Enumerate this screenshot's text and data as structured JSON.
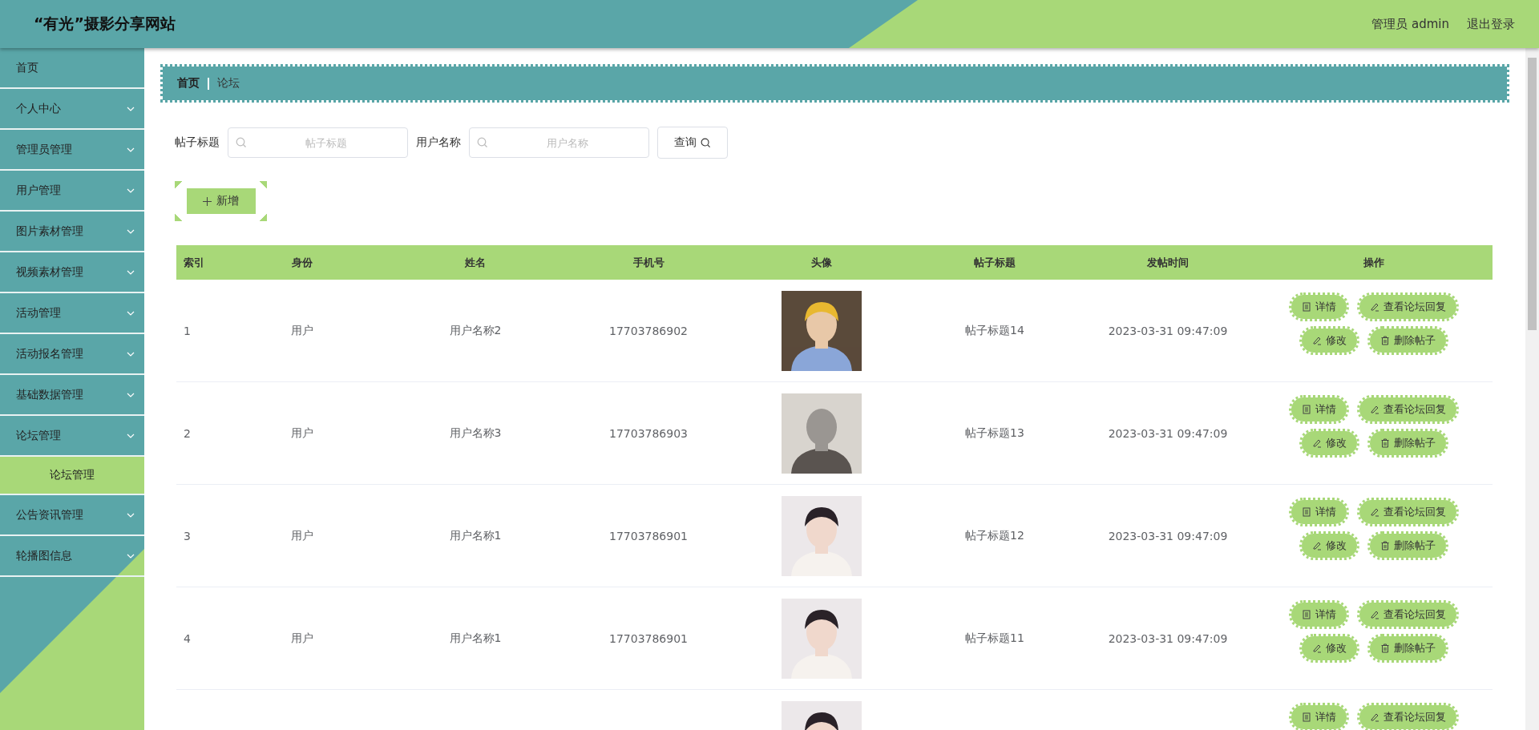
{
  "header": {
    "title": "“有光”摄影分享网站",
    "user": "管理员 admin",
    "logout": "退出登录"
  },
  "sidebar": {
    "items": [
      {
        "label": "首页",
        "kind": "link"
      },
      {
        "label": "个人中心",
        "kind": "menu"
      },
      {
        "label": "管理员管理",
        "kind": "menu"
      },
      {
        "label": "用户管理",
        "kind": "menu"
      },
      {
        "label": "图片素材管理",
        "kind": "menu"
      },
      {
        "label": "视频素材管理",
        "kind": "menu"
      },
      {
        "label": "活动管理",
        "kind": "menu"
      },
      {
        "label": "活动报名管理",
        "kind": "menu"
      },
      {
        "label": "基础数据管理",
        "kind": "menu"
      },
      {
        "label": "论坛管理",
        "kind": "menu",
        "children": [
          {
            "label": "论坛管理",
            "selected": true
          }
        ]
      },
      {
        "label": "公告资讯管理",
        "kind": "menu"
      },
      {
        "label": "轮播图信息",
        "kind": "menu"
      }
    ]
  },
  "breadcrumb": [
    "首页",
    "论坛"
  ],
  "search": {
    "fields": [
      {
        "label": "帖子标题",
        "placeholder": "帖子标题"
      },
      {
        "label": "用户名称",
        "placeholder": "用户名称"
      }
    ],
    "button": "查询"
  },
  "add_button": "新增",
  "table": {
    "columns": [
      "索引",
      "身份",
      "姓名",
      "手机号",
      "头像",
      "帖子标题",
      "发帖时间",
      "操作"
    ],
    "rows": [
      {
        "index": "1",
        "role": "用户",
        "name": "用户名称2",
        "phone": "17703786902",
        "avatar": {
          "kind": "picture"
        },
        "title": "帖子标题14",
        "time": "2023-03-31 09:47:09",
        "actions": [
          {
            "kind": "detail",
            "label": "详情"
          },
          {
            "kind": "reply",
            "label": "查看论坛回复"
          },
          {
            "kind": "edit",
            "label": "修改"
          },
          {
            "kind": "delete",
            "label": "删除帖子"
          }
        ]
      },
      {
        "index": "2",
        "role": "用户",
        "name": "用户名称3",
        "phone": "17703786903",
        "avatar": {
          "kind": "picture"
        },
        "title": "帖子标题13",
        "time": "2023-03-31 09:47:09",
        "actions": [
          {
            "kind": "detail",
            "label": "详情"
          },
          {
            "kind": "reply",
            "label": "查看论坛回复"
          },
          {
            "kind": "edit",
            "label": "修改"
          },
          {
            "kind": "delete",
            "label": "删除帖子"
          }
        ]
      },
      {
        "index": "3",
        "role": "用户",
        "name": "用户名称1",
        "phone": "17703786901",
        "avatar": {
          "kind": "picture"
        },
        "title": "帖子标题12",
        "time": "2023-03-31 09:47:09",
        "actions": [
          {
            "kind": "detail",
            "label": "详情"
          },
          {
            "kind": "reply",
            "label": "查看论坛回复"
          },
          {
            "kind": "edit",
            "label": "修改"
          },
          {
            "kind": "delete",
            "label": "删除帖子"
          }
        ]
      },
      {
        "index": "4",
        "role": "用户",
        "name": "用户名称1",
        "phone": "17703786901",
        "avatar": {
          "kind": "picture"
        },
        "title": "帖子标题11",
        "time": "2023-03-31 09:47:09",
        "actions": [
          {
            "kind": "detail",
            "label": "详情"
          },
          {
            "kind": "reply",
            "label": "查看论坛回复"
          },
          {
            "kind": "edit",
            "label": "修改"
          },
          {
            "kind": "delete",
            "label": "删除帖子"
          }
        ]
      },
      {
        "avatar": {
          "kind": "picture"
        },
        "actions": [
          {
            "kind": "detail",
            "label": "详情"
          },
          {
            "kind": "reply",
            "label": "查看论坛回复"
          }
        ]
      }
    ]
  }
}
